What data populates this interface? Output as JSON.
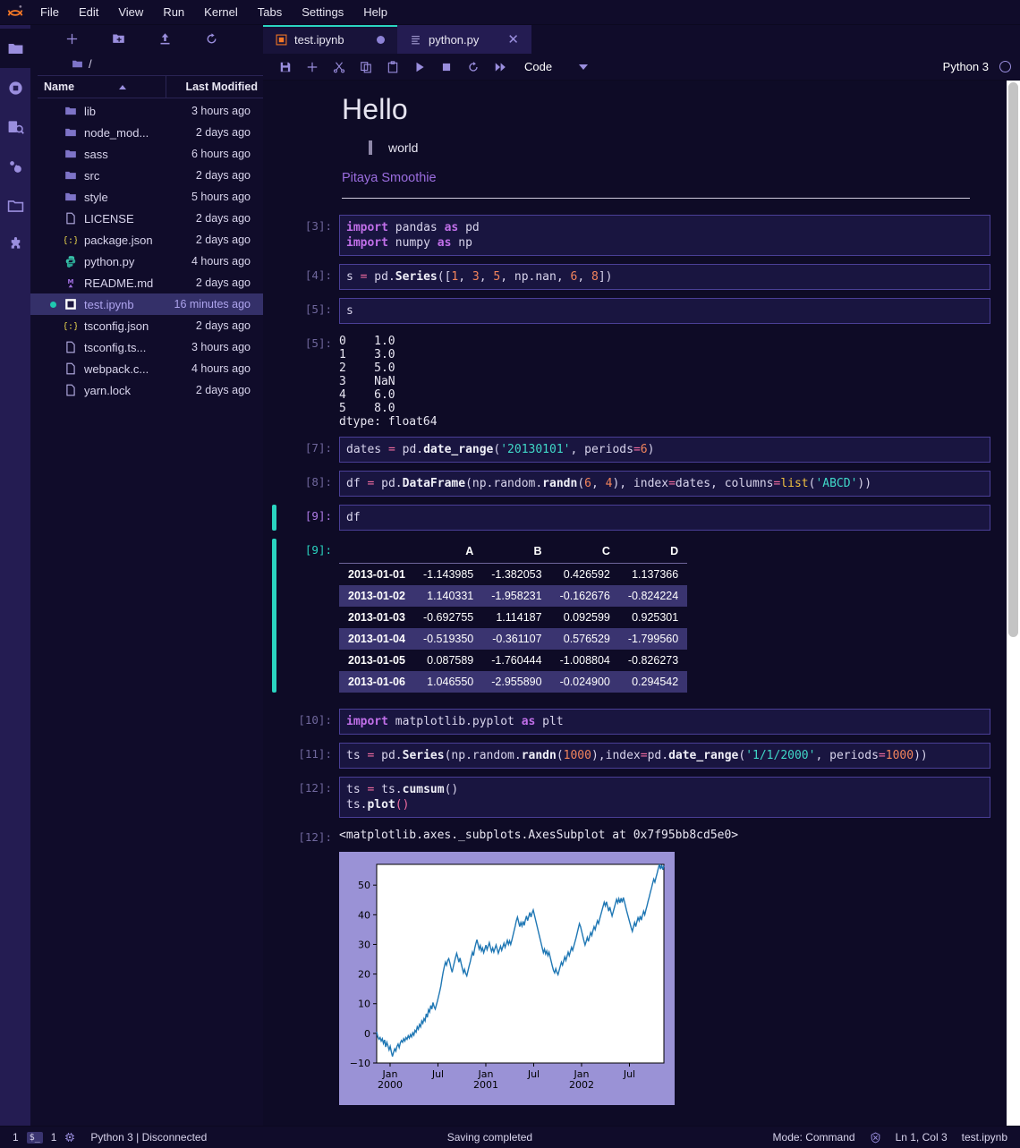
{
  "app": {
    "logo_icon": "jupyter-logo-icon",
    "menu": [
      {
        "label": "File"
      },
      {
        "label": "Edit"
      },
      {
        "label": "View"
      },
      {
        "label": "Run"
      },
      {
        "label": "Kernel"
      },
      {
        "label": "Tabs"
      },
      {
        "label": "Settings"
      },
      {
        "label": "Help"
      }
    ]
  },
  "activity_bar": {
    "items": [
      {
        "name": "file-browser-icon",
        "active": true
      },
      {
        "name": "running-terminals-icon",
        "active": false
      },
      {
        "name": "command-palette-icon",
        "active": false
      },
      {
        "name": "property-inspector-icon",
        "active": false
      },
      {
        "name": "open-tabs-icon",
        "active": false
      },
      {
        "name": "extension-manager-icon",
        "active": false
      }
    ]
  },
  "file_browser": {
    "toolbar": [
      {
        "name": "new-launcher-button",
        "icon": "plus-icon"
      },
      {
        "name": "new-folder-button",
        "icon": "folder-plus-icon"
      },
      {
        "name": "upload-button",
        "icon": "upload-icon"
      },
      {
        "name": "refresh-button",
        "icon": "refresh-icon"
      }
    ],
    "breadcrumb": "/",
    "columns": {
      "name": "Name",
      "modified": "Last Modified"
    },
    "sort": "ascending",
    "items": [
      {
        "name": "lib",
        "modified": "3 hours ago",
        "icon": "folder-icon",
        "selected": false,
        "running": false
      },
      {
        "name": "node_mod...",
        "modified": "2 days ago",
        "icon": "folder-icon",
        "selected": false,
        "running": false
      },
      {
        "name": "sass",
        "modified": "6 hours ago",
        "icon": "folder-icon",
        "selected": false,
        "running": false
      },
      {
        "name": "src",
        "modified": "2 days ago",
        "icon": "folder-icon",
        "selected": false,
        "running": false
      },
      {
        "name": "style",
        "modified": "5 hours ago",
        "icon": "folder-icon",
        "selected": false,
        "running": false
      },
      {
        "name": "LICENSE",
        "modified": "2 days ago",
        "icon": "file-icon",
        "selected": false,
        "running": false
      },
      {
        "name": "package.json",
        "modified": "2 days ago",
        "icon": "json-icon",
        "selected": false,
        "running": false
      },
      {
        "name": "python.py",
        "modified": "4 hours ago",
        "icon": "python-icon",
        "selected": false,
        "running": false
      },
      {
        "name": "README.md",
        "modified": "2 days ago",
        "icon": "markdown-icon",
        "selected": false,
        "running": false
      },
      {
        "name": "test.ipynb",
        "modified": "16 minutes ago",
        "icon": "notebook-icon",
        "selected": true,
        "running": true
      },
      {
        "name": "tsconfig.json",
        "modified": "2 days ago",
        "icon": "json-icon",
        "selected": false,
        "running": false
      },
      {
        "name": "tsconfig.ts...",
        "modified": "3 hours ago",
        "icon": "file-icon",
        "selected": false,
        "running": false
      },
      {
        "name": "webpack.c...",
        "modified": "4 hours ago",
        "icon": "file-icon",
        "selected": false,
        "running": false
      },
      {
        "name": "yarn.lock",
        "modified": "2 days ago",
        "icon": "file-icon",
        "selected": false,
        "running": false
      }
    ]
  },
  "tabs": [
    {
      "label": "test.ipynb",
      "icon": "notebook-icon",
      "active": true,
      "dirty": true
    },
    {
      "label": "python.py",
      "icon": "text-file-icon",
      "active": false,
      "dirty": false
    }
  ],
  "notebook_toolbar": {
    "buttons": [
      {
        "name": "save-button",
        "icon": "save-icon"
      },
      {
        "name": "insert-cell-button",
        "icon": "plus-icon"
      },
      {
        "name": "cut-cell-button",
        "icon": "scissors-icon"
      },
      {
        "name": "copy-cell-button",
        "icon": "copy-icon"
      },
      {
        "name": "paste-cell-button",
        "icon": "paste-icon"
      },
      {
        "name": "run-cell-button",
        "icon": "play-icon"
      },
      {
        "name": "interrupt-kernel-button",
        "icon": "stop-icon"
      },
      {
        "name": "restart-kernel-button",
        "icon": "restart-icon"
      },
      {
        "name": "restart-run-all-button",
        "icon": "fast-forward-icon"
      }
    ],
    "cell_type": "Code",
    "kernel_name": "Python 3",
    "kernel_status_icon": "kernel-idle-circle-icon"
  },
  "markdown": {
    "heading": "Hello",
    "blockquote": "world",
    "link": "Pitaya Smoothie"
  },
  "cells": [
    {
      "prompt": "[3]:",
      "lines": [
        [
          {
            "t": "import",
            "c": "kw"
          },
          {
            "t": " pandas ",
            "c": "pl"
          },
          {
            "t": "as",
            "c": "kw"
          },
          {
            "t": " pd",
            "c": "pl"
          }
        ],
        [
          {
            "t": "import",
            "c": "kw"
          },
          {
            "t": " numpy ",
            "c": "pl"
          },
          {
            "t": "as",
            "c": "kw"
          },
          {
            "t": " np",
            "c": "pl"
          }
        ]
      ]
    },
    {
      "prompt": "[4]:",
      "lines": [
        [
          {
            "t": "s ",
            "c": "pl"
          },
          {
            "t": "=",
            "c": "op"
          },
          {
            "t": " pd.",
            "c": "pl"
          },
          {
            "t": "Series",
            "c": "fn"
          },
          {
            "t": "([",
            "c": "pl"
          },
          {
            "t": "1",
            "c": "num"
          },
          {
            "t": ", ",
            "c": "pl"
          },
          {
            "t": "3",
            "c": "num"
          },
          {
            "t": ", ",
            "c": "pl"
          },
          {
            "t": "5",
            "c": "num"
          },
          {
            "t": ", np.nan, ",
            "c": "pl"
          },
          {
            "t": "6",
            "c": "num"
          },
          {
            "t": ", ",
            "c": "pl"
          },
          {
            "t": "8",
            "c": "num"
          },
          {
            "t": "])",
            "c": "pl"
          }
        ]
      ]
    },
    {
      "prompt": "[5]:",
      "lines": [
        [
          {
            "t": "s",
            "c": "pl"
          }
        ]
      ]
    }
  ],
  "series_output": {
    "prompt": "[5]:",
    "text": "0    1.0\n1    3.0\n2    5.0\n3    NaN\n4    6.0\n5    8.0\ndtype: float64"
  },
  "cells2": [
    {
      "prompt": "[7]:",
      "lines": [
        [
          {
            "t": "dates ",
            "c": "pl"
          },
          {
            "t": "=",
            "c": "op"
          },
          {
            "t": " pd.",
            "c": "pl"
          },
          {
            "t": "date_range",
            "c": "fn"
          },
          {
            "t": "(",
            "c": "pl"
          },
          {
            "t": "'20130101'",
            "c": "str"
          },
          {
            "t": ", periods",
            "c": "pl"
          },
          {
            "t": "=",
            "c": "op"
          },
          {
            "t": "6",
            "c": "num"
          },
          {
            "t": ")",
            "c": "pl"
          }
        ],
        [
          {
            "t": "",
            "c": "pl"
          }
        ]
      ]
    },
    {
      "prompt": "[8]:",
      "lines": [
        [
          {
            "t": "df ",
            "c": "pl"
          },
          {
            "t": "=",
            "c": "op"
          },
          {
            "t": " pd.",
            "c": "pl"
          },
          {
            "t": "DataFrame",
            "c": "fn"
          },
          {
            "t": "(np.random.",
            "c": "pl"
          },
          {
            "t": "randn",
            "c": "fn"
          },
          {
            "t": "(",
            "c": "pl"
          },
          {
            "t": "6",
            "c": "num"
          },
          {
            "t": ", ",
            "c": "pl"
          },
          {
            "t": "4",
            "c": "num"
          },
          {
            "t": "), index",
            "c": "pl"
          },
          {
            "t": "=",
            "c": "op"
          },
          {
            "t": "dates, columns",
            "c": "pl"
          },
          {
            "t": "=",
            "c": "op"
          },
          {
            "t": "list",
            "c": "bi"
          },
          {
            "t": "(",
            "c": "pl"
          },
          {
            "t": "'ABCD'",
            "c": "str"
          },
          {
            "t": "))",
            "c": "pl"
          }
        ]
      ]
    }
  ],
  "df_cell": {
    "prompt": "[9]:",
    "code": "df",
    "active": true
  },
  "dataframe_output": {
    "prompt": "[9]:",
    "columns": [
      "",
      "A",
      "B",
      "C",
      "D"
    ],
    "rows": [
      {
        "index": "2013-01-01",
        "values": [
          "-1.143985",
          "-1.382053",
          "0.426592",
          "1.137366"
        ]
      },
      {
        "index": "2013-01-02",
        "values": [
          "1.140331",
          "-1.958231",
          "-0.162676",
          "-0.824224"
        ]
      },
      {
        "index": "2013-01-03",
        "values": [
          "-0.692755",
          "1.114187",
          "0.092599",
          "0.925301"
        ]
      },
      {
        "index": "2013-01-04",
        "values": [
          "-0.519350",
          "-0.361107",
          "0.576529",
          "-1.799560"
        ]
      },
      {
        "index": "2013-01-05",
        "values": [
          "0.087589",
          "-1.760444",
          "-1.008804",
          "-0.826273"
        ]
      },
      {
        "index": "2013-01-06",
        "values": [
          "1.046550",
          "-2.955890",
          "-0.024900",
          "0.294542"
        ]
      }
    ]
  },
  "cells3": [
    {
      "prompt": "[10]:",
      "lines": [
        [
          {
            "t": "import",
            "c": "kw"
          },
          {
            "t": " matplotlib.pyplot ",
            "c": "pl"
          },
          {
            "t": "as",
            "c": "kw"
          },
          {
            "t": " plt",
            "c": "pl"
          }
        ]
      ]
    },
    {
      "prompt": "[11]:",
      "lines": [
        [
          {
            "t": "ts ",
            "c": "pl"
          },
          {
            "t": "=",
            "c": "op"
          },
          {
            "t": " pd.",
            "c": "pl"
          },
          {
            "t": "Series",
            "c": "fn"
          },
          {
            "t": "(np.random.",
            "c": "pl"
          },
          {
            "t": "randn",
            "c": "fn"
          },
          {
            "t": "(",
            "c": "pl"
          },
          {
            "t": "1000",
            "c": "num"
          },
          {
            "t": "),index",
            "c": "pl"
          },
          {
            "t": "=",
            "c": "op"
          },
          {
            "t": "pd.",
            "c": "pl"
          },
          {
            "t": "date_range",
            "c": "fn"
          },
          {
            "t": "(",
            "c": "pl"
          },
          {
            "t": "'1/1/2000'",
            "c": "str"
          },
          {
            "t": ", periods",
            "c": "pl"
          },
          {
            "t": "=",
            "c": "op"
          },
          {
            "t": "1000",
            "c": "num"
          },
          {
            "t": "))",
            "c": "pl"
          }
        ]
      ]
    },
    {
      "prompt": "[12]:",
      "lines": [
        [
          {
            "t": "ts ",
            "c": "pl"
          },
          {
            "t": "=",
            "c": "op"
          },
          {
            "t": " ts.",
            "c": "pl"
          },
          {
            "t": "cumsum",
            "c": "fn"
          },
          {
            "t": "()",
            "c": "pl"
          }
        ],
        [
          {
            "t": "ts.",
            "c": "pl"
          },
          {
            "t": "plot",
            "c": "fn"
          },
          {
            "t": "(",
            "c": "op"
          },
          {
            "t": ")",
            "c": "op"
          }
        ]
      ]
    }
  ],
  "plot_repr": {
    "prompt": "[12]:",
    "text": "<matplotlib.axes._subplots.AxesSubplot at 0x7f95bb8cd5e0>"
  },
  "chart_data": {
    "type": "line",
    "title": "",
    "xlabel": "",
    "ylabel": "",
    "ylim": [
      -10,
      57
    ],
    "yticks": [
      -10,
      0,
      10,
      20,
      30,
      40,
      50
    ],
    "xticks": [
      "Jan",
      "Jul",
      "Jan",
      "Jul",
      "Jan",
      "Jul"
    ],
    "xtick_years": [
      "2000",
      "",
      "2001",
      "",
      "2002",
      ""
    ],
    "grid": false,
    "legend": null,
    "line_color": "#1f77b4",
    "series": [
      {
        "name": "ts",
        "values": [
          0.5,
          -1.2,
          -2.0,
          -1.4,
          -2.6,
          -1.8,
          -3.4,
          -2.2,
          -4.6,
          -3.0,
          -4.2,
          -5.6,
          -4.4,
          -6.2,
          -7.8,
          -6.4,
          -5.2,
          -6.0,
          -4.4,
          -3.6,
          -4.8,
          -3.2,
          -2.4,
          -3.0,
          -1.8,
          -2.6,
          -1.4,
          -2.0,
          -0.8,
          -1.6,
          -0.4,
          -1.2,
          0.2,
          -0.6,
          1.0,
          0.4,
          2.2,
          1.4,
          3.0,
          2.2,
          4.2,
          3.4,
          5.0,
          4.2,
          6.6,
          5.4,
          8.0,
          7.2,
          9.4,
          8.2,
          10.4,
          9.0,
          8.2,
          9.6,
          11.0,
          12.6,
          14.2,
          16.0,
          18.4,
          20.6,
          22.4,
          24.0,
          23.0,
          24.6,
          25.2,
          23.8,
          22.0,
          20.6,
          22.4,
          24.0,
          25.6,
          27.0,
          25.6,
          24.0,
          25.4,
          23.6,
          22.0,
          20.4,
          21.6,
          20.2,
          19.4,
          21.0,
          22.6,
          24.0,
          25.8,
          27.4,
          26.2,
          28.6,
          30.2,
          31.6,
          30.0,
          28.4,
          29.6,
          27.8,
          28.8,
          27.2,
          28.4,
          29.8,
          28.2,
          29.4,
          30.6,
          29.0,
          27.6,
          28.8,
          27.4,
          28.6,
          29.8,
          28.4,
          27.0,
          28.2,
          29.4,
          28.0,
          29.2,
          30.4,
          29.0,
          30.2,
          31.4,
          30.0,
          31.2,
          30.0,
          31.4,
          33.0,
          34.6,
          36.2,
          38.0,
          39.2,
          37.6,
          36.0,
          37.4,
          36.2,
          37.8,
          36.4,
          38.2,
          39.6,
          38.0,
          39.4,
          40.8,
          39.2,
          40.6,
          41.6,
          40.0,
          38.4,
          36.8,
          35.2,
          33.6,
          32.0,
          30.4,
          28.8,
          27.2,
          28.4,
          26.8,
          27.8,
          26.2,
          27.4,
          25.8,
          24.2,
          22.6,
          21.2,
          20.4,
          21.8,
          20.6,
          19.8,
          21.2,
          22.6,
          24.0,
          23.0,
          24.4,
          25.8,
          24.6,
          26.0,
          27.4,
          26.2,
          27.6,
          29.0,
          28.0,
          29.4,
          30.8,
          32.2,
          33.8,
          35.4,
          37.0,
          36.0,
          34.4,
          32.8,
          31.2,
          29.8,
          31.0,
          32.4,
          31.0,
          32.6,
          34.0,
          33.0,
          34.6,
          36.0,
          35.0,
          36.6,
          38.0,
          37.0,
          38.6,
          40.0,
          41.4,
          42.8,
          44.2,
          43.0,
          44.4,
          42.8,
          41.2,
          42.6,
          41.0,
          39.6,
          41.0,
          42.4,
          43.8,
          45.2,
          44.0,
          45.4,
          44.0,
          45.6,
          44.2,
          45.8,
          44.4,
          42.8,
          41.2,
          39.8,
          38.4,
          37.0,
          35.6,
          34.4,
          36.0,
          37.4,
          36.0,
          37.6,
          39.0,
          38.0,
          39.6,
          38.2,
          39.8,
          41.2,
          40.0,
          41.6,
          43.0,
          44.6,
          46.0,
          47.6,
          49.0,
          50.6,
          52.0,
          51.0,
          52.6,
          54.0,
          55.6,
          57.0,
          55.4,
          56.8,
          55.2,
          56.6
        ]
      }
    ]
  },
  "status_bar": {
    "terminal_count": "1",
    "terminal_icon": "terminal-icon",
    "kernel_count": "1",
    "kernel_icon": "cpu-icon",
    "kernel_status": "Python 3 | Disconnected",
    "message": "Saving completed",
    "mode": "Mode: Command",
    "trust_icon": "untrusted-icon",
    "cursor": "Ln 1, Col 3",
    "filename": "test.ipynb"
  }
}
